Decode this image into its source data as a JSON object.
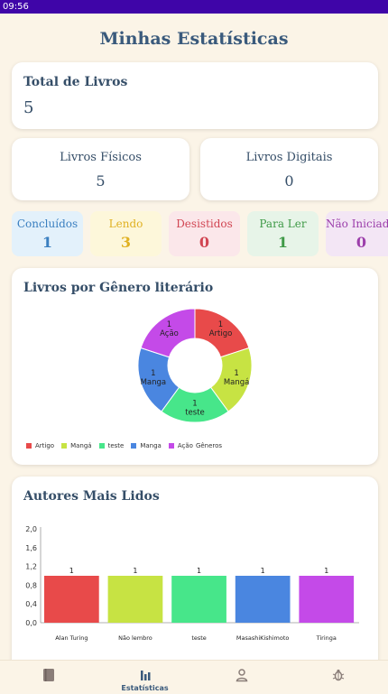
{
  "status_bar": {
    "time": "09:56"
  },
  "page": {
    "title": "Minhas Estatísticas"
  },
  "summary": {
    "total": {
      "label": "Total de Livros",
      "value": "5"
    },
    "physical": {
      "label": "Livros Físicos",
      "value": "5"
    },
    "digital": {
      "label": "Livros Digitais",
      "value": "0"
    }
  },
  "statuses": [
    {
      "label": "Concluídos",
      "value": "1",
      "bg": "#e3f1fb",
      "color": "#3a7fc0"
    },
    {
      "label": "Lendo",
      "value": "3",
      "bg": "#fdf7da",
      "color": "#e0b122"
    },
    {
      "label": "Desistidos",
      "value": "0",
      "bg": "#fbe7ea",
      "color": "#d14552"
    },
    {
      "label": "Para Ler",
      "value": "1",
      "bg": "#e7f4e8",
      "color": "#3f9a47"
    },
    {
      "label": "Não Iniciados",
      "value": "0",
      "bg": "#f3e6f5",
      "color": "#9c3fab"
    }
  ],
  "genre_card": {
    "title": "Livros por Gênero literário"
  },
  "authors_card": {
    "title": "Autores Mais Lidos"
  },
  "chart_data": [
    {
      "type": "pie",
      "title": "Livros por Gênero literário",
      "categories": [
        "Artigo",
        "Mangá",
        "teste",
        "Manga",
        "Ação"
      ],
      "values": [
        1,
        1,
        1,
        1,
        1
      ],
      "slice_labels": [
        "1\nArtigo",
        "1\nMangá",
        "1\nteste",
        "1\nManga",
        "1\nAção"
      ],
      "colors": [
        "#e84a4a",
        "#c7e343",
        "#47e68a",
        "#4a86e0",
        "#c44ae8"
      ],
      "legend_extra": "Gêneros",
      "legend": "bottom-left"
    },
    {
      "type": "bar",
      "title": "Autores Mais Lidos",
      "categories": [
        "Alan Turing",
        "Não lembro",
        "teste",
        "MasashiKishimoto",
        "Tiringa"
      ],
      "values": [
        1,
        1,
        1,
        1,
        1
      ],
      "value_labels": [
        "1",
        "1",
        "1",
        "1",
        "1"
      ],
      "colors": [
        "#e84a4a",
        "#c7e343",
        "#47e68a",
        "#4a86e0",
        "#c44ae8"
      ],
      "ylim": [
        0,
        2
      ],
      "yticks": [
        "0,0",
        "0,4",
        "0,8",
        "1,2",
        "1,6",
        "2,0"
      ],
      "grid": false
    }
  ],
  "bottom_nav": [
    {
      "label": "",
      "icon": "book-icon"
    },
    {
      "label": "Estatísticas",
      "icon": "bar-chart-icon"
    },
    {
      "label": "",
      "icon": "person-icon"
    },
    {
      "label": "",
      "icon": "bug-icon"
    }
  ]
}
